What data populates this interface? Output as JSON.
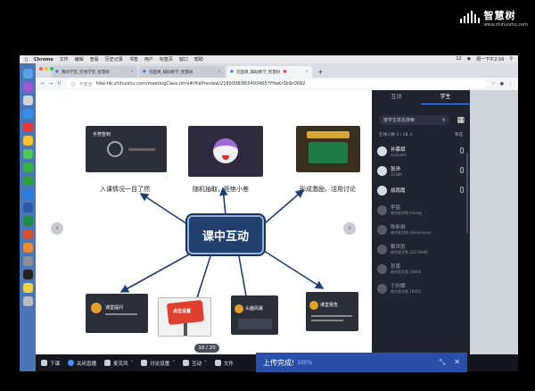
{
  "watermark": {
    "brand": "智慧树",
    "sub": "www.zhihuishu.com"
  },
  "menubar": {
    "app": "Chrome",
    "items": [
      "文件",
      "编辑",
      "查看",
      "历史记录",
      "书签",
      "用户",
      "标签页",
      "窗口",
      "帮助"
    ],
    "status_right": "周一下午2:16",
    "battery": "12"
  },
  "tabs": [
    {
      "label": "我的学堂_在线学堂_智慧树",
      "active": false
    },
    {
      "label": "见面课_辅助教学_智慧树",
      "active": false
    },
    {
      "label": "见面课_辅助教学_智慧树",
      "active": true
    }
  ],
  "address": {
    "security": "不安全",
    "url": "hike-hb.zhihuishu.com/meetingClass.html#/filePreview/2180008/865493465?YHeKrSb9c0682"
  },
  "slide": {
    "center_label": "课中互动",
    "captions": {
      "top_left": "入课情况一目了然",
      "top_mid": "随机抽取，拒绝小差",
      "top_right": "形成激励，活用讨论"
    },
    "thumb_labels": {
      "top_left": "手势签到",
      "bottom_1": "课堂提问",
      "bottom_2": "点击设置",
      "bottom_3": "头脑风暴",
      "bottom_4": "课堂报告"
    },
    "page_indicator": "10 / 20"
  },
  "sidebar": {
    "tabs": [
      {
        "label": "互动",
        "active": false
      },
      {
        "label": "学生",
        "active": true
      }
    ],
    "search_placeholder": "按学生姓名搜索",
    "count_label": "在线人数 3 / 18 人",
    "sort_label": "筛选",
    "students": [
      {
        "name": "孙慕斌",
        "sub": "sunjiabin"
      },
      {
        "name": "张沛",
        "sub": "32389"
      },
      {
        "name": "战雨霞",
        "sub": ""
      },
      {
        "name": "李猛",
        "sub": "南京医学院   limeng"
      },
      {
        "name": "陈新娟",
        "sub": "南京医学院   chenxinjuan"
      },
      {
        "name": "戴世雨",
        "sub": "南京医学院   22170466"
      },
      {
        "name": "张蕾",
        "sub": "南京医学院   16654"
      },
      {
        "name": "于树娜",
        "sub": "南京医学院   18455"
      }
    ]
  },
  "toolbar": {
    "items": [
      "下课",
      "关闭直播",
      "麦克风",
      "讨论设置",
      "互动",
      "文件"
    ]
  },
  "upload": {
    "label": "上传完成!",
    "pct": "100%"
  }
}
